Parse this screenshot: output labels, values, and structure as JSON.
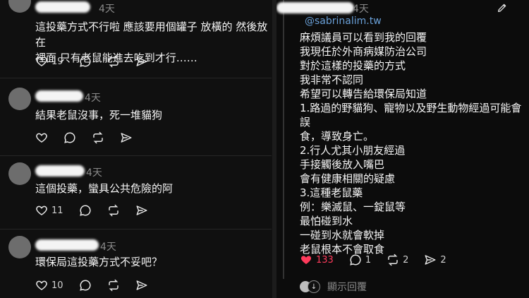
{
  "left_posts": [
    {
      "time": "4天",
      "text_lines": [
        "這投藥方式不行啦  應該要用個罐子 放橫的 然後放在",
        "裡面  只有老鼠能進去吃到才行……"
      ],
      "likes": "19"
    },
    {
      "time": "4天",
      "text_lines": [
        "結果老鼠沒事，死一堆貓狗"
      ],
      "likes": ""
    },
    {
      "time": "4天",
      "text_lines": [
        "這個投藥，蠻具公共危險的阿"
      ],
      "likes": "11"
    },
    {
      "time": "4天",
      "text_lines": [
        "環保局這投藥方式不妥吧？"
      ],
      "likes": "10"
    }
  ],
  "right_post": {
    "time": "4天",
    "handle": "@sabrinalim.tw",
    "text_lines": [
      "麻煩議員可以看到我的回覆",
      "我現任於外商病媒防治公司",
      "對於這樣的投藥的方式",
      "我非常不認同",
      "希望可以轉告給環保局知道",
      "1.路過的野貓狗、寵物以及野生動物經過可能會誤",
      "食，導致身亡。",
      "2.行人尤其小朋友經過",
      "手接觸後放入嘴巴",
      "會有健康相關的疑慮",
      "3.這種老鼠藥",
      "例：樂滅鼠、一錠鼠等",
      "最怕碰到水",
      "一碰到水就會軟掉",
      "老鼠根本不會取食"
    ],
    "likes": "133",
    "comments": "1",
    "reposts": "2",
    "shares": "2",
    "show_replies": "顯示回覆"
  },
  "colors": {
    "like_active": "#ff3b5c",
    "handle": "#6aa0d8"
  }
}
